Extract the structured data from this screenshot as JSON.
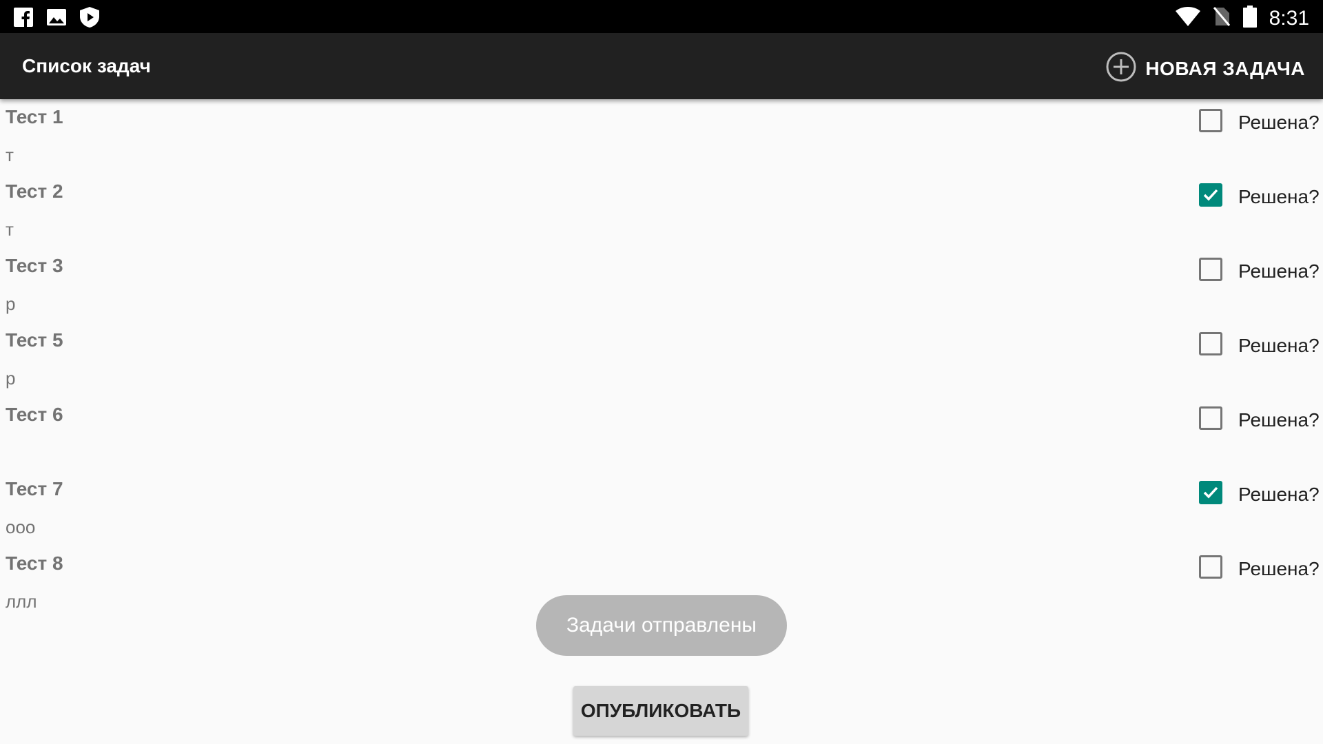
{
  "status_bar": {
    "time": "8:31",
    "left_icons": [
      "facebook-icon",
      "gallery-icon",
      "shield-play-icon"
    ],
    "right_icons": [
      "wifi-icon",
      "no-sim-icon",
      "battery-icon"
    ]
  },
  "app_bar": {
    "title": "Список задач",
    "new_task_label": "НОВАЯ ЗАДАЧА",
    "new_task_icon": "add-circle-icon"
  },
  "tasks": [
    {
      "title": "Тест 1",
      "description": "т",
      "solved": false,
      "checkbox_label": "Решена?"
    },
    {
      "title": "Тест 2",
      "description": "т",
      "solved": true,
      "checkbox_label": "Решена?"
    },
    {
      "title": "Тест 3",
      "description": "р",
      "solved": false,
      "checkbox_label": "Решена?"
    },
    {
      "title": "Тест 5",
      "description": "р",
      "solved": false,
      "checkbox_label": "Решена?"
    },
    {
      "title": "Тест 6",
      "description": "",
      "solved": false,
      "checkbox_label": "Решена?"
    },
    {
      "title": "Тест 7",
      "description": "ооо",
      "solved": true,
      "checkbox_label": "Решена?"
    },
    {
      "title": "Тест 8",
      "description": "ллл",
      "solved": false,
      "checkbox_label": "Решена?"
    }
  ],
  "toast": {
    "text": "Задачи отправлены"
  },
  "publish_button": {
    "label": "ОПУБЛИКОВАТЬ"
  },
  "colors": {
    "status_bar": "#000000",
    "app_bar": "#212121",
    "background": "#fafafa",
    "accent": "#00897b",
    "task_text": "#737373",
    "toast": "#b6b6b6",
    "button": "#d6d6d6"
  }
}
